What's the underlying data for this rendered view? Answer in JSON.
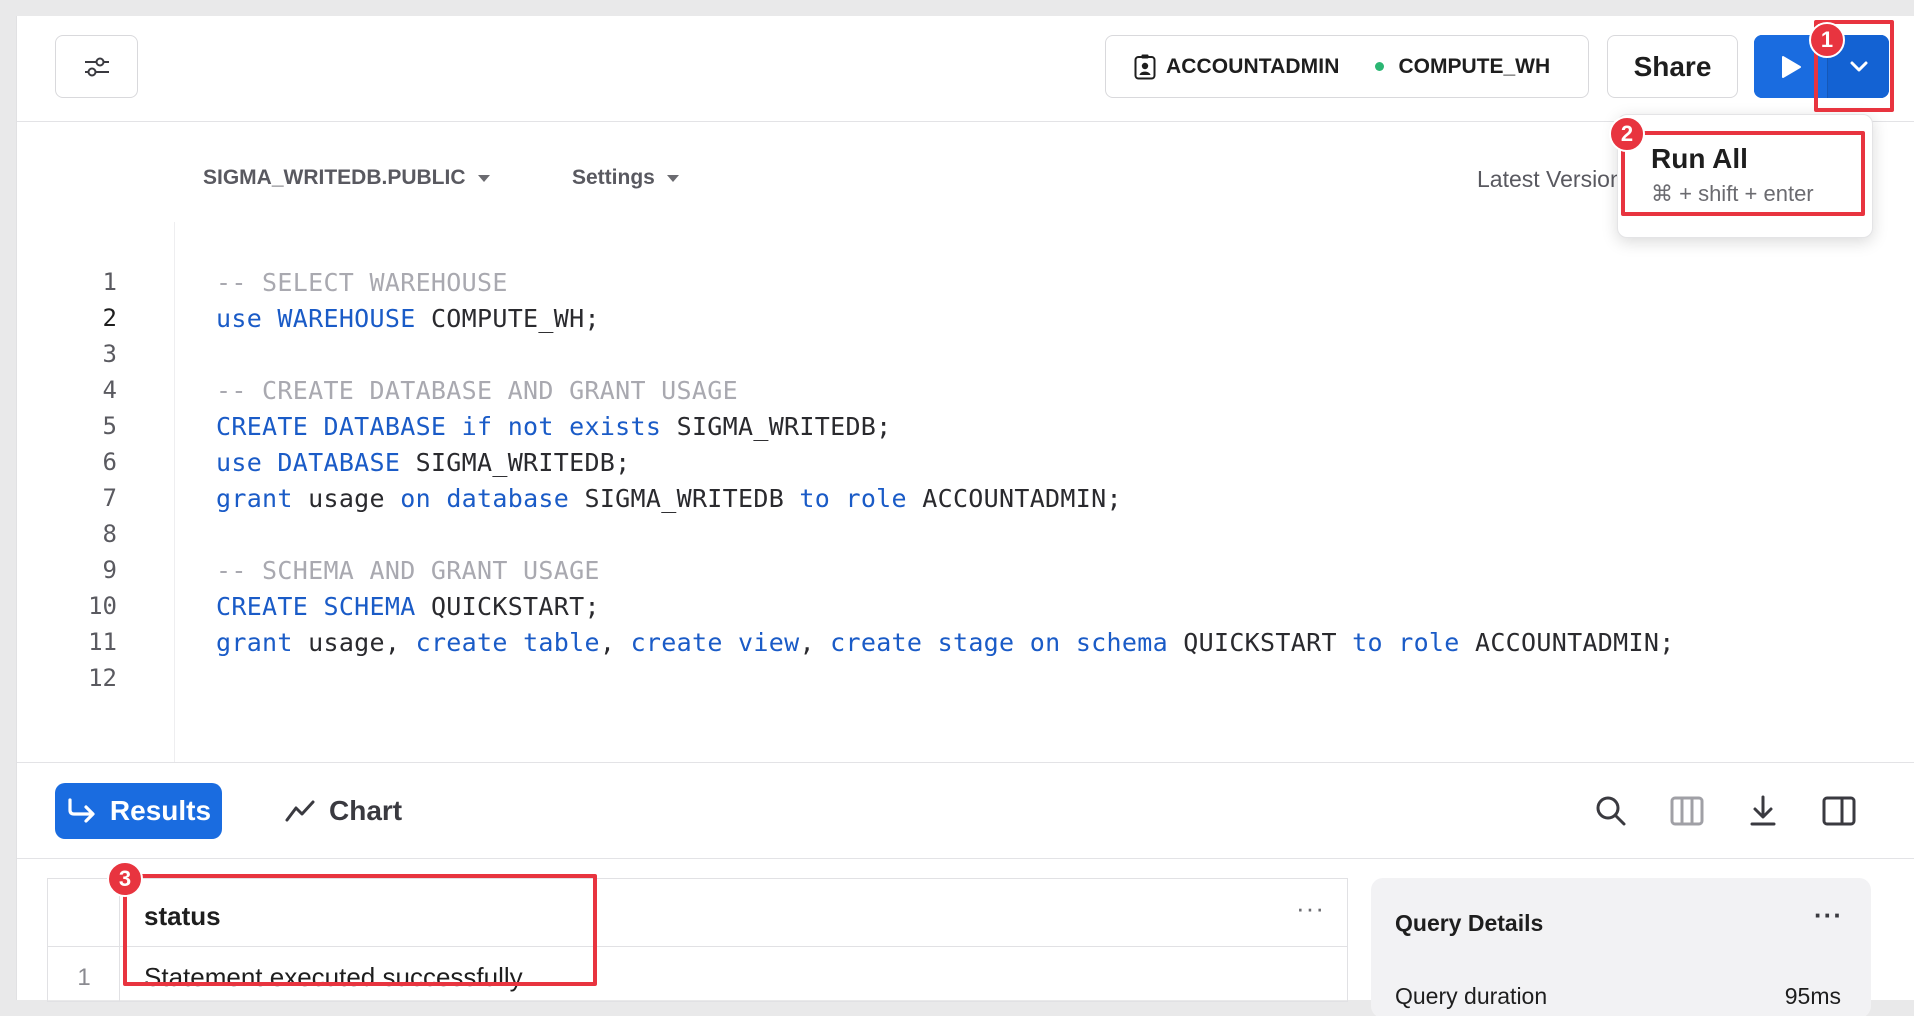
{
  "toolbar": {
    "role": "ACCOUNTADMIN",
    "warehouse": "COMPUTE_WH",
    "share_label": "Share"
  },
  "run_menu": {
    "title": "Run All",
    "shortcut": "⌘ + shift + enter"
  },
  "editor": {
    "database": "SIGMA_WRITEDB.PUBLIC",
    "settings_label": "Settings",
    "version_label": "Latest Version",
    "line_numbers": [
      "1",
      "2",
      "3",
      "4",
      "5",
      "6",
      "7",
      "8",
      "9",
      "10",
      "11",
      "12"
    ],
    "active_line": 2,
    "lines": [
      "-- SELECT WAREHOUSE",
      "use WAREHOUSE COMPUTE_WH;",
      "",
      "-- CREATE DATABASE AND GRANT USAGE",
      "CREATE DATABASE if not exists SIGMA_WRITEDB;",
      "use DATABASE SIGMA_WRITEDB;",
      "grant usage on database SIGMA_WRITEDB to role ACCOUNTADMIN;",
      "",
      "-- SCHEMA AND GRANT USAGE",
      "CREATE SCHEMA QUICKSTART;",
      "grant usage, create table, create view, create stage on schema QUICKSTART to role ACCOUNTADMIN;",
      ""
    ]
  },
  "results": {
    "results_tab": "Results",
    "chart_tab": "Chart",
    "column_header": "status",
    "more_glyph": "···",
    "row_index": "1",
    "row_value": "Statement executed successfully."
  },
  "query_details": {
    "title": "Query Details",
    "more_glyph": "···",
    "duration_label": "Query duration",
    "duration_value": "95ms"
  },
  "annotations": {
    "badge_1": "1",
    "badge_2": "2",
    "badge_3": "3",
    "color": "#e8343f"
  },
  "colors": {
    "primary": "#1a6ce0",
    "keyword": "#1a5bc7",
    "comment": "#a9a9b0",
    "status_dot": "#2bb673"
  }
}
